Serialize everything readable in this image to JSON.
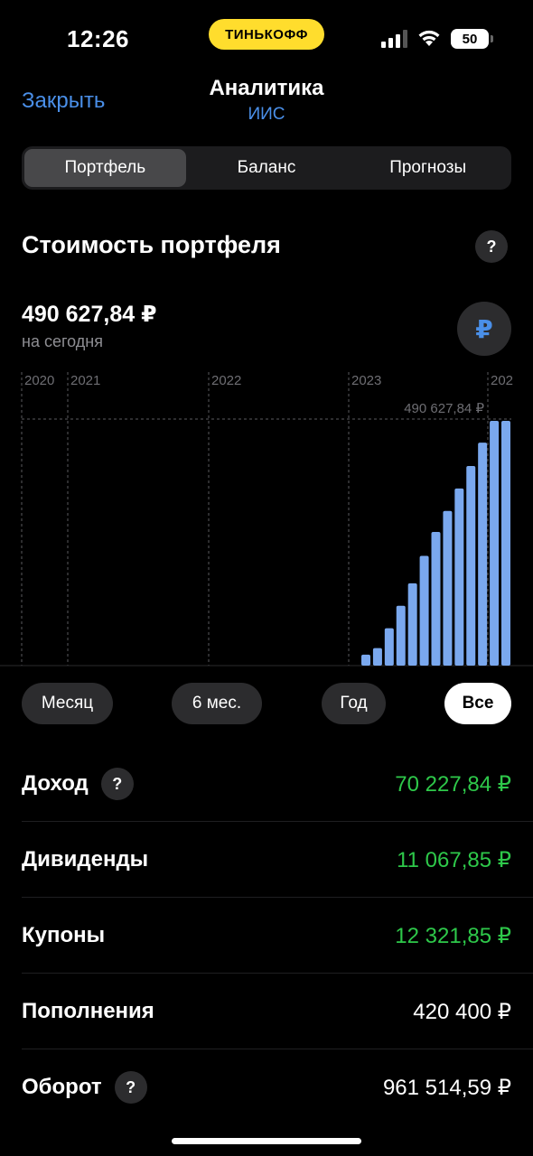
{
  "status": {
    "time": "12:26",
    "brand": "ТИНЬКОФФ",
    "battery": "50"
  },
  "header": {
    "close_label": "Закрыть",
    "title": "Аналитика",
    "subtitle": "ИИС"
  },
  "tabs": [
    {
      "label": "Портфель",
      "active": true
    },
    {
      "label": "Баланс",
      "active": false
    },
    {
      "label": "Прогнозы",
      "active": false
    }
  ],
  "portfolio": {
    "title": "Стоимость портфеля",
    "help": "?",
    "value": "490 627,84 ₽",
    "value_caption": "на сегодня",
    "currency_symbol": "₽"
  },
  "chart_data": {
    "type": "bar",
    "year_labels": [
      "2020",
      "2021",
      "2022",
      "2023",
      "202"
    ],
    "current_value_label": "490 627,84 ₽",
    "ylim": [
      0,
      490627.84
    ],
    "values": [
      22000,
      35000,
      75000,
      120000,
      165000,
      220000,
      268000,
      310000,
      355000,
      400000,
      447000,
      490627.84,
      490627.84
    ],
    "color": "#7aa8ee"
  },
  "periods": [
    {
      "label": "Месяц",
      "active": false
    },
    {
      "label": "6 мес.",
      "active": false
    },
    {
      "label": "Год",
      "active": false
    },
    {
      "label": "Все",
      "active": true
    }
  ],
  "stats": [
    {
      "label": "Доход",
      "value": "70 227,84 ₽",
      "positive": true,
      "help": true
    },
    {
      "label": "Дивиденды",
      "value": "11 067,85 ₽",
      "positive": true,
      "help": false
    },
    {
      "label": "Купоны",
      "value": "12 321,85 ₽",
      "positive": true,
      "help": false
    },
    {
      "label": "Пополнения",
      "value": "420 400 ₽",
      "positive": false,
      "help": false
    },
    {
      "label": "Оборот",
      "value": "961 514,59 ₽",
      "positive": false,
      "help": true
    }
  ],
  "colors": {
    "accent": "#4a8fe8",
    "positive": "#2ec84a",
    "brand": "#ffdd2d"
  }
}
